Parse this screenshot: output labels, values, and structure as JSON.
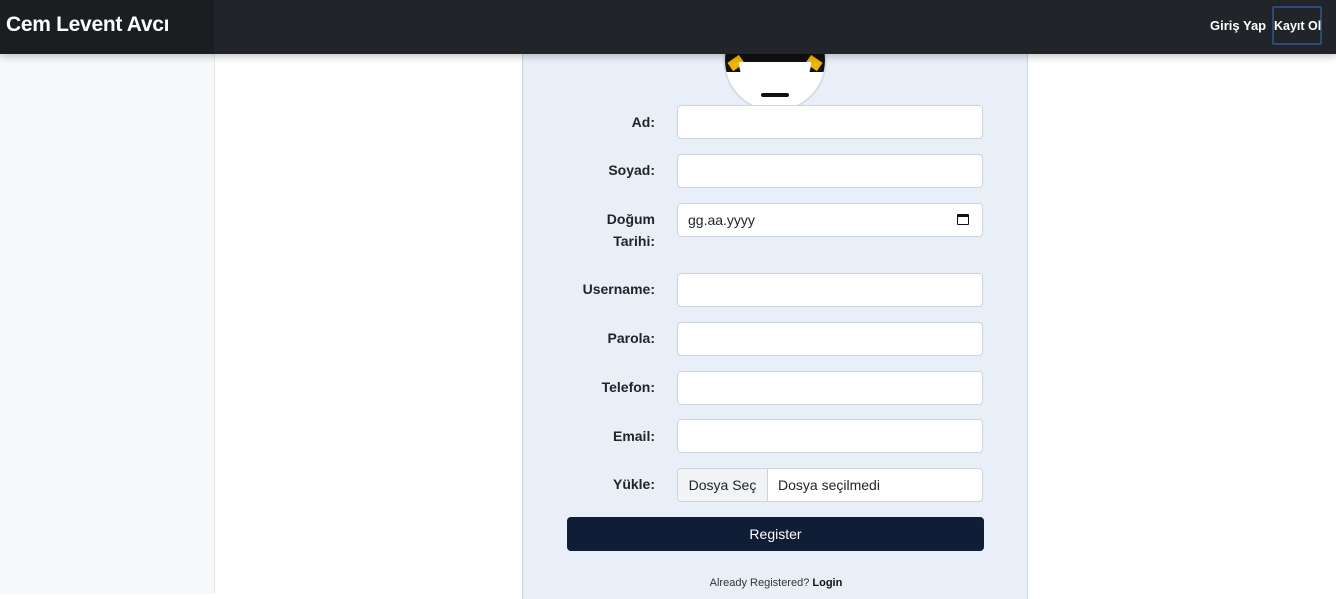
{
  "brand": "Cem Levent Avcı",
  "nav": {
    "login": "Giriş Yap",
    "register": "Kayıt Ol"
  },
  "form": {
    "first_name_label": "Ad:",
    "last_name_label": "Soyad:",
    "birth_date_label_1": "Doğum",
    "birth_date_label_2": "Tarihi:",
    "birth_date_placeholder": "gg.aa.yyyy",
    "username_label": "Username:",
    "password_label": "Parola:",
    "phone_label": "Telefon:",
    "email_label": "Email:",
    "upload_label": "Yükle:",
    "file_button": "Dosya Seç",
    "file_status": "Dosya seçilmedi",
    "submit": "Register",
    "footer_prefix": "Already Registered?",
    "footer_link": "Login"
  },
  "colors": {
    "navbar": "#212529",
    "card": "#e9eff8",
    "button": "#0f1d36"
  }
}
